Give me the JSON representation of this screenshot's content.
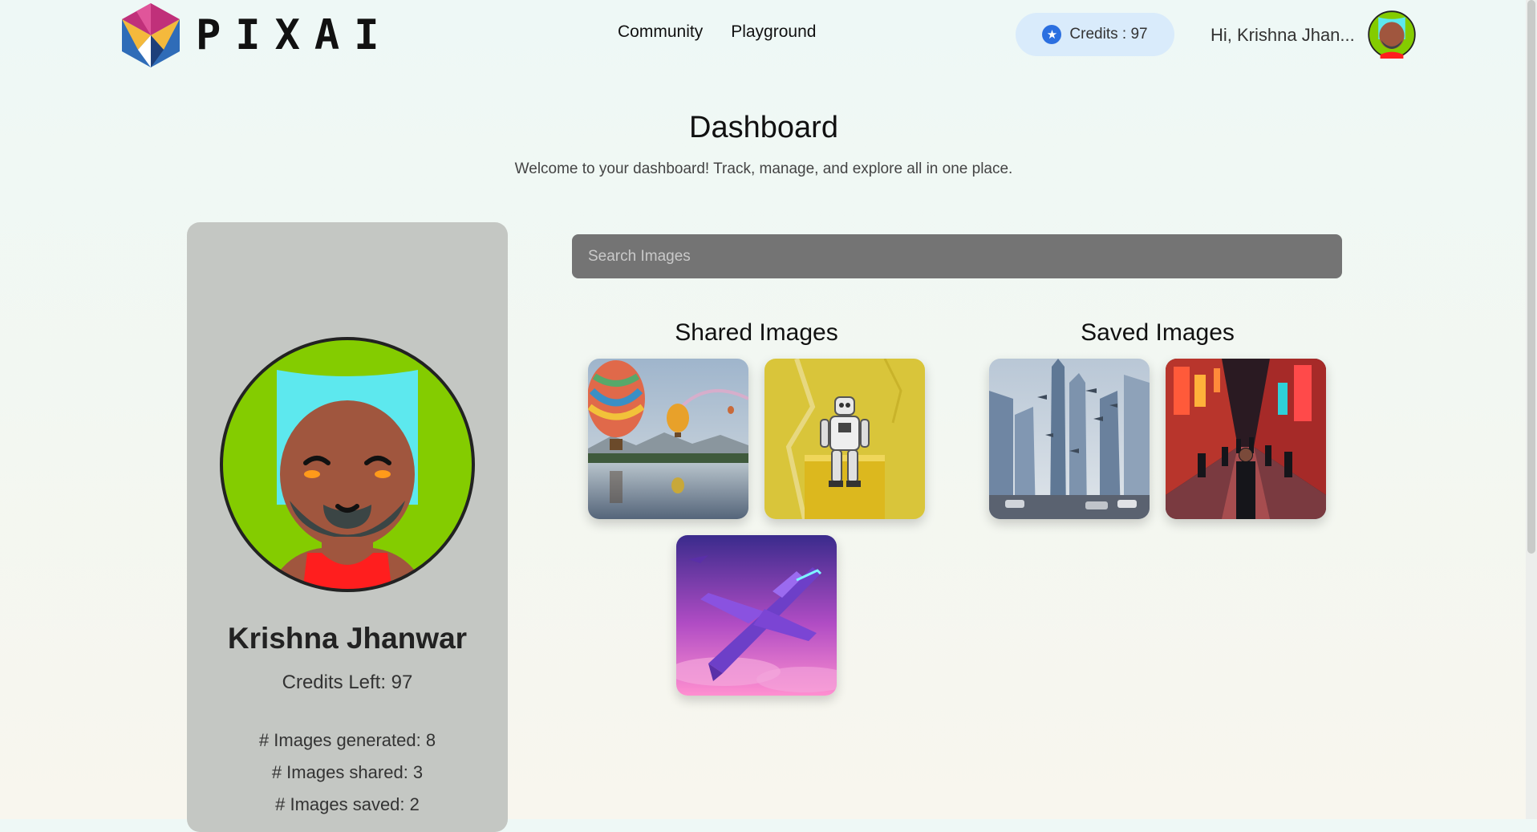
{
  "header": {
    "brand": "PIXAI",
    "nav": [
      {
        "label": "Community"
      },
      {
        "label": "Playground"
      }
    ],
    "credits_label": "Credits : 97",
    "greeting": "Hi, Krishna Jhan..."
  },
  "page": {
    "title": "Dashboard",
    "subtitle": "Welcome to your dashboard! Track, manage, and explore all in one place."
  },
  "profile": {
    "name": "Krishna Jhanwar",
    "credits_left": "Credits Left: 97",
    "stats": [
      "# Images generated: 8",
      "# Images shared: 3",
      "# Images saved: 2"
    ]
  },
  "search": {
    "placeholder": "Search Images"
  },
  "shared": {
    "title": "Shared Images",
    "images": [
      {
        "name": "hot-air-balloons-lake-image"
      },
      {
        "name": "robot-sitting-on-yellow-block-image"
      },
      {
        "name": "purple-jet-plane-image"
      }
    ]
  },
  "saved": {
    "title": "Saved Images",
    "images": [
      {
        "name": "futuristic-city-aircraft-image"
      },
      {
        "name": "neon-market-street-image"
      }
    ]
  },
  "colors": {
    "credits_pill": "#d9ebfb",
    "star": "#2b6fe0",
    "profile_card": "#c4c7c3",
    "search_bg": "#747474",
    "avatar_bg": "#84cc00"
  }
}
